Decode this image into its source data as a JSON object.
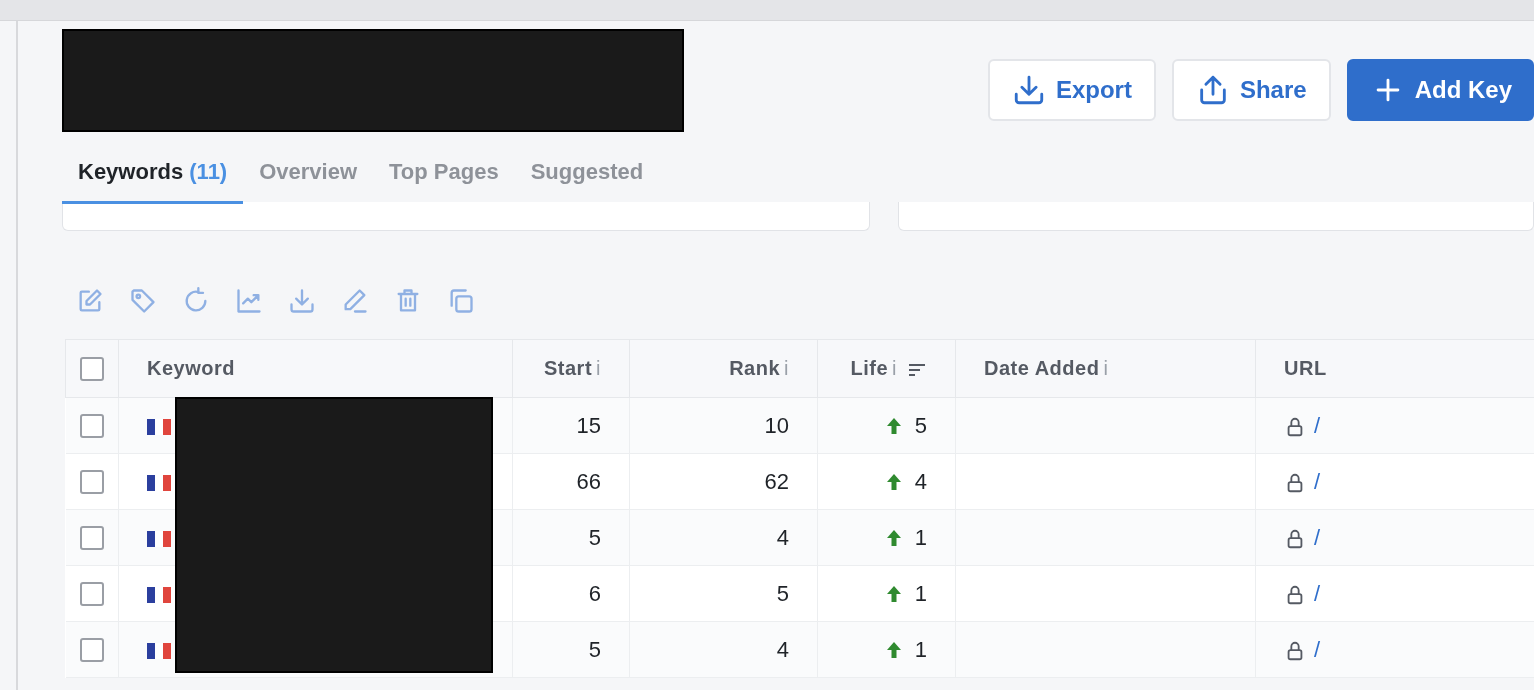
{
  "header": {
    "buttons": [
      {
        "label": "Export",
        "kind": "export"
      },
      {
        "label": "Share",
        "kind": "share"
      },
      {
        "label": "Add Key",
        "kind": "add"
      }
    ]
  },
  "tabs": [
    {
      "label": "Keywords",
      "count": "(11)",
      "selected": true
    },
    {
      "label": "Overview",
      "selected": false
    },
    {
      "label": "Top Pages",
      "selected": false
    },
    {
      "label": "Suggested",
      "selected": false
    }
  ],
  "toolbar": [
    {
      "kind": "edit"
    },
    {
      "kind": "tag"
    },
    {
      "kind": "refresh"
    },
    {
      "kind": "chart"
    },
    {
      "kind": "download"
    },
    {
      "kind": "pencil"
    },
    {
      "kind": "trash"
    },
    {
      "kind": "copy"
    }
  ],
  "table": {
    "all_checked": false,
    "columns": [
      {
        "label": "Keyword"
      },
      {
        "label": "Start",
        "info": "i"
      },
      {
        "label": "Rank",
        "info": "i"
      },
      {
        "label": "Life",
        "info": "i",
        "sortable": true
      },
      {
        "label": "Date Added",
        "info": "i"
      },
      {
        "label": "URL"
      }
    ],
    "rows": [
      {
        "checked": false,
        "start": "15",
        "rank": "10",
        "rising": true,
        "life": "5",
        "url": "/"
      },
      {
        "checked": false,
        "start": "66",
        "rank": "62",
        "rising": true,
        "life": "4",
        "url": "/"
      },
      {
        "checked": false,
        "start": "5",
        "rank": "4",
        "rising": true,
        "life": "1",
        "url": "/"
      },
      {
        "checked": false,
        "start": "6",
        "rank": "5",
        "rising": true,
        "life": "1",
        "url": "/"
      },
      {
        "checked": false,
        "start": "5",
        "rank": "4",
        "rising": true,
        "life": "1",
        "url": "/"
      }
    ]
  }
}
